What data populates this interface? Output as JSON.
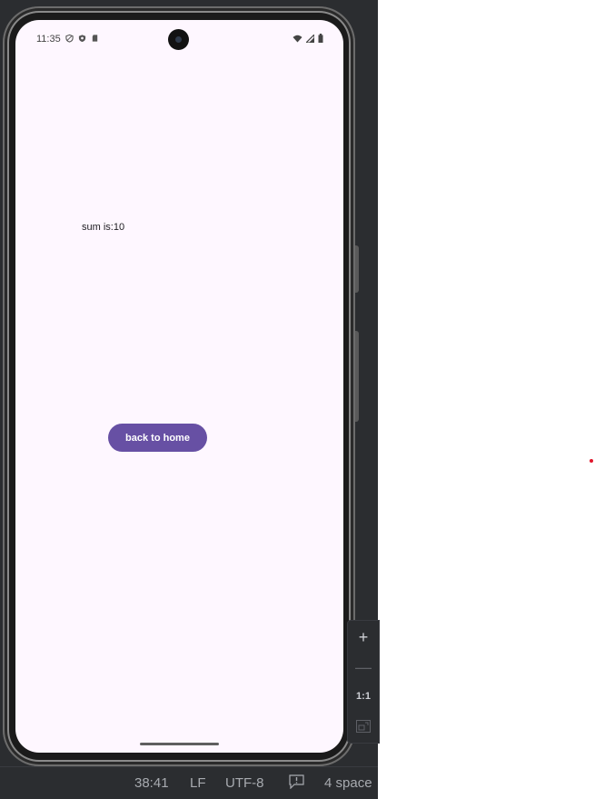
{
  "status_bar": {
    "time": "11:35",
    "icons_left": [
      "vpn-icon",
      "shield-icon",
      "sd-card-icon"
    ],
    "icons_right": [
      "wifi-icon",
      "signal-icon",
      "battery-icon"
    ]
  },
  "app": {
    "sum_text": "sum is:10",
    "back_button_label": "back to home",
    "accent_color": "#6750a4",
    "background_color": "#fef7ff"
  },
  "zoom_controls": {
    "zoom_in": "+",
    "zoom_out": "—",
    "actual_size": "1:1"
  },
  "ide_status": {
    "cursor_position": "38:41",
    "line_separator": "LF",
    "encoding": "UTF-8",
    "indent": "4 space"
  }
}
